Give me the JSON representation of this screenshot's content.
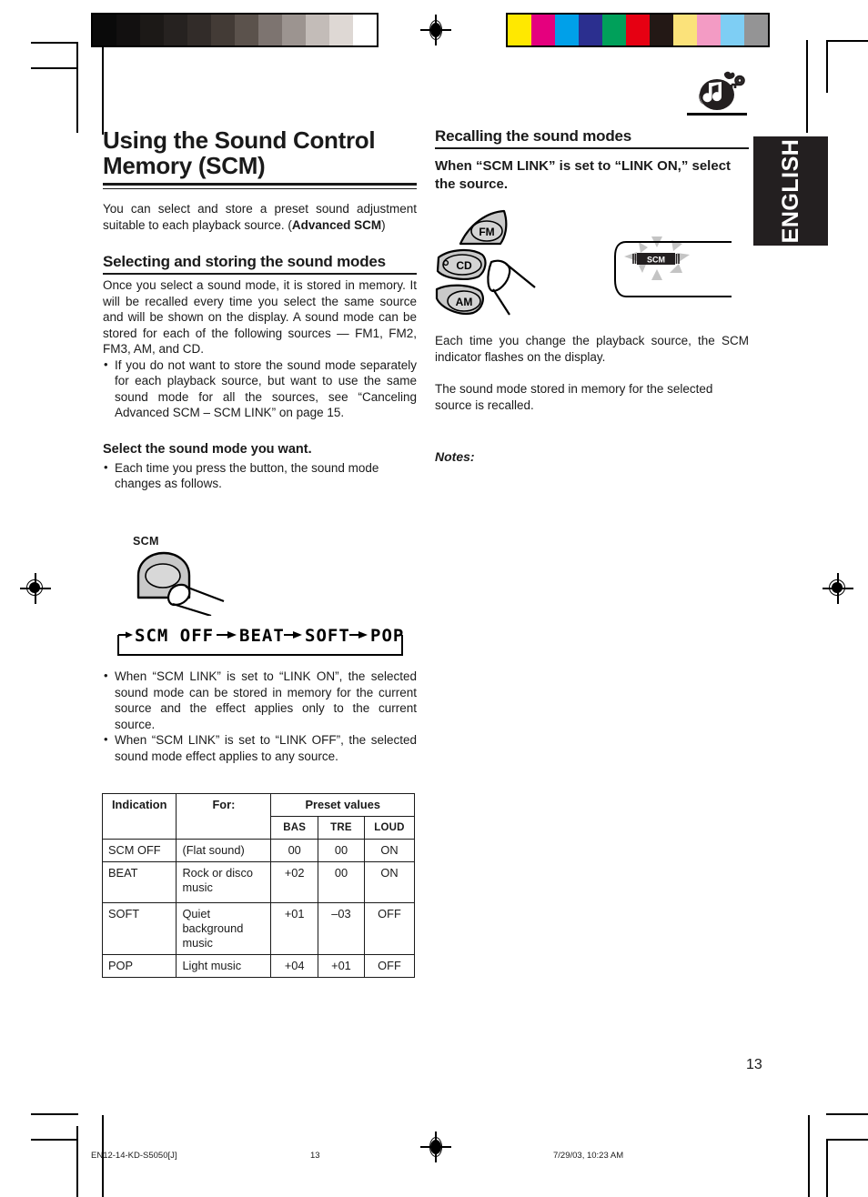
{
  "page": {
    "number": "13",
    "language_tab": "ENGLISH",
    "music_icon": "music-note-key-icon"
  },
  "left_column": {
    "title": "Using the Sound Control Memory (SCM)",
    "intro_part1": "You can select and store a preset sound adjustment suitable to each playback source. (",
    "intro_bold": "Advanced SCM",
    "intro_part2": ")",
    "section_heading": "Selecting and storing the sound modes",
    "section_paragraph": "Once you select a sound mode, it is stored in memory. It will be recalled every time you select the same source and will be shown on the display. A sound mode can be stored for each of the following sources — FM1, FM2, FM3, AM, and CD.",
    "bullet_store": "If you do not want to store the sound mode separately for each playback source, but want to use the same sound mode for all the sources, see “Canceling Advanced SCM – SCM LINK” on page 15.",
    "select_heading": "Select the sound mode you want.",
    "select_bullet": "Each time you press the button, the sound mode changes as follows.",
    "scm_button_label": "SCM",
    "lcd_sequence": [
      "SCM OFF",
      "BEAT",
      "SOFT",
      "POP"
    ],
    "bullet_link_on": "When “SCM LINK” is set to “LINK ON”, the selected sound mode can be stored in memory for the current source and the effect applies only to the current source.",
    "bullet_link_off": "When “SCM LINK” is set to “LINK OFF”, the selected sound mode effect applies to any source."
  },
  "table": {
    "header_row1": [
      "Indication",
      "For:",
      "Preset values"
    ],
    "header_row2": [
      "BAS",
      "TRE",
      "LOUD"
    ],
    "rows": [
      {
        "indication": "SCM OFF",
        "for": "(Flat sound)",
        "bas": "00",
        "tre": "00",
        "loud": "ON"
      },
      {
        "indication": "BEAT",
        "for": "Rock or disco music",
        "bas": "+02",
        "tre": "00",
        "loud": "ON"
      },
      {
        "indication": "SOFT",
        "for": "Quiet background music",
        "bas": "+01",
        "tre": "–03",
        "loud": "OFF"
      },
      {
        "indication": "POP",
        "for": "Light music",
        "bas": "+04",
        "tre": "+01",
        "loud": "OFF"
      }
    ]
  },
  "right_column": {
    "section_heading": "Recalling the sound modes",
    "bold_lead": "When “SCM LINK” is set to “LINK ON,” select the source.",
    "source_buttons": [
      "FM",
      "CD",
      "AM"
    ],
    "panel_indicator": "SCM",
    "paragraph1": "Each time you change the playback source, the SCM indicator flashes on the display.",
    "paragraph2": "The sound mode stored in memory for the selected source is recalled.",
    "notes_label": "Notes:"
  },
  "print_marks": {
    "footer_file": "EN12-14-KD-S5050[J]",
    "footer_page": "13",
    "footer_date": "7/29/03, 10:23 AM",
    "grayscale_bar": [
      "#0a0a0a",
      "#121010",
      "#1c1917",
      "#262220",
      "#322c29",
      "#433b36",
      "#5b524c",
      "#7d7470",
      "#9c9490",
      "#c3bcb8",
      "#ded8d4",
      "#ffffff"
    ],
    "color_bar": [
      "#ffe800",
      "#e5007e",
      "#00a0e9",
      "#2b2f8f",
      "#00a05a",
      "#e60012",
      "#231815",
      "#fbe27a",
      "#f39bc4",
      "#7ecef4",
      "#949495"
    ]
  }
}
